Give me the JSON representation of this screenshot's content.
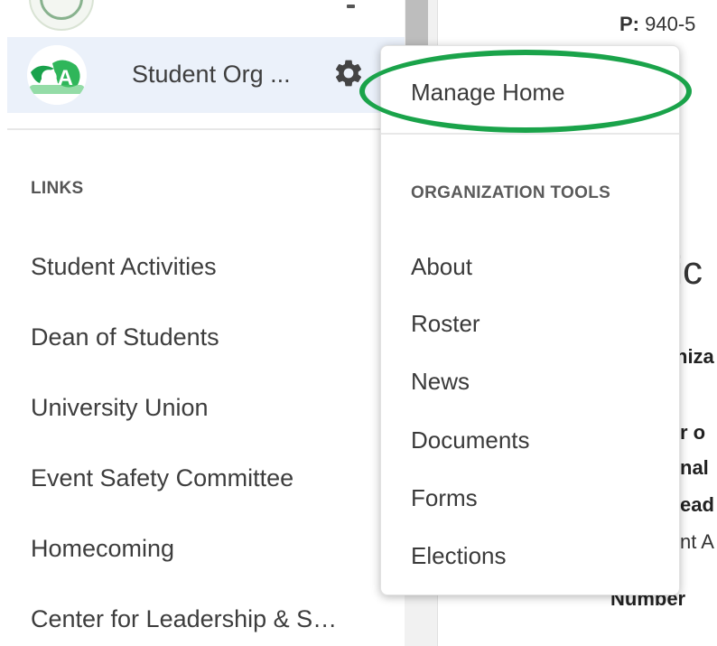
{
  "sidebar": {
    "org_name": "Student Org ...",
    "links_heading": "LINKS",
    "links": [
      "Student Activities",
      "Dean of Students",
      "University Union",
      "Event Safety Committee",
      "Homecoming",
      "Center for Leadership & S…"
    ]
  },
  "dropdown": {
    "manage_home": "Manage Home",
    "section_heading": "ORGANIZATION TOOLS",
    "items": [
      "About",
      "Roster",
      "News",
      "Documents",
      "Forms",
      "Elections"
    ]
  },
  "main": {
    "phone_label": "P:",
    "phone_partial": " 940-5",
    "heading_partial": "tic",
    "fragments": [
      "niza",
      "r o",
      "nal",
      "ead",
      "nt A",
      "Number"
    ]
  },
  "colors": {
    "accent_green": "#1aa34a",
    "selected_row_bg": "#ebf1fa"
  },
  "icons": {
    "org_logo": "oa-logo-icon",
    "settings": "gear-icon"
  }
}
